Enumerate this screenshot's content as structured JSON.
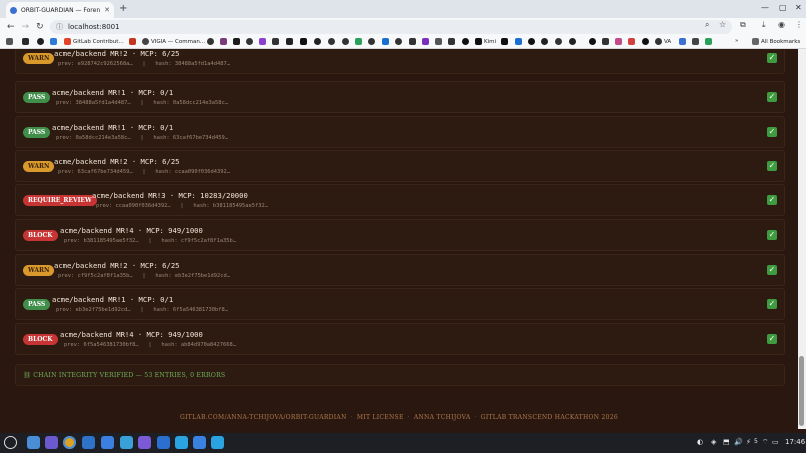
{
  "browser": {
    "tab_title": "ORBIT-GUARDIAN — Foren",
    "url": "localhost:8001",
    "bookmarks": [
      "GitLab Contribut…",
      "VIGIA — Comman…",
      "Kimi",
      "VA"
    ],
    "all_bookmarks": "All Bookmarks"
  },
  "entries": [
    {
      "badge": "WARN",
      "kind": "warn",
      "title": "acme/backend MR!2  ·  MCP: 6/25",
      "prev": "prev: e928742c9262568a…",
      "hash": "hash: 38488a5fd1a4d487…"
    },
    {
      "badge": "PASS",
      "kind": "pass",
      "title": "acme/backend MR!1  ·  MCP: 0/1",
      "prev": "prev: 38488a5fd1a4d487…",
      "hash": "hash: 0a58dcc214e3a58c…"
    },
    {
      "badge": "PASS",
      "kind": "pass",
      "title": "acme/backend MR!1  ·  MCP: 0/1",
      "prev": "prev: 0a58dcc214e3a58c…",
      "hash": "hash: 63caf67be734d459…"
    },
    {
      "badge": "WARN",
      "kind": "warn",
      "title": "acme/backend MR!2  ·  MCP: 6/25",
      "prev": "prev: 63caf67be734d459…",
      "hash": "hash: ccaa090f036d4392…"
    },
    {
      "badge": "REQUIRE_REVIEW",
      "kind": "review",
      "title": "acme/backend MR!3  ·  MCP: 10283/20000",
      "prev": "prev: ccaa090f036d4392…",
      "hash": "hash: b381185495ae5f32…"
    },
    {
      "badge": "BLOCK",
      "kind": "block",
      "title": "acme/backend MR!4  ·  MCP: 949/1000",
      "prev": "prev: b381185495ae5f32…",
      "hash": "hash: cf9f5c2af8f1a35b…"
    },
    {
      "badge": "WARN",
      "kind": "warn",
      "title": "acme/backend MR!2  ·  MCP: 6/25",
      "prev": "prev: cf9f5c2af8f1a35b…",
      "hash": "hash: eb3e2f75be1d92cd…"
    },
    {
      "badge": "PASS",
      "kind": "pass",
      "title": "acme/backend MR!1  ·  MCP: 0/1",
      "prev": "prev: eb3e2f75be1d92cd…",
      "hash": "hash: 6f5a546381730bf8…"
    },
    {
      "badge": "BLOCK",
      "kind": "block",
      "title": "acme/backend MR!4  ·  MCP: 949/1000",
      "prev": "prev: 6f5a546381730bf8…",
      "hash": "hash: ab84d970a8427668…"
    }
  ],
  "chain_status": "⛓ CHAIN INTEGRITY VERIFIED — 53 ENTRIES, 0 ERRORS",
  "footer": [
    "GITLAB.COM/ANNA-TCHIJOVA/ORBIT-GUARDIAN",
    "MIT LICENSE",
    "ANNA TCHIJOVA",
    "GITLAB TRANSCEND HACKATHON 2026"
  ],
  "taskbar": {
    "clock": "17:46",
    "badge": "5"
  }
}
